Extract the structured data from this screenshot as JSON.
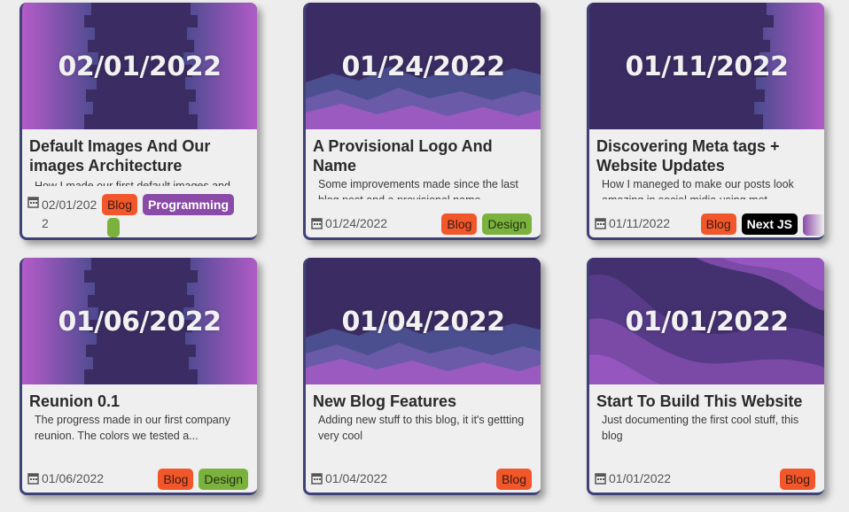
{
  "cards": [
    {
      "thumb_date": "02/01/2022",
      "title": "Default Images And Our images Architecture",
      "desc": "How I made our first default images and...",
      "date": "02/01/2022",
      "tags": [
        "Blog",
        "Programming"
      ]
    },
    {
      "thumb_date": "01/24/2022",
      "title": "A Provisional Logo And Name",
      "desc": "Some improvements made since the last blog post and a provisional name...",
      "date": "01/24/2022",
      "tags": [
        "Blog",
        "Design"
      ]
    },
    {
      "thumb_date": "01/11/2022",
      "title": "Discovering Meta tags + Website Updates",
      "desc": "How I maneged to make our posts look amazing in social midia using met...",
      "date": "01/11/2022",
      "tags": [
        "Blog",
        "Next JS"
      ]
    },
    {
      "thumb_date": "01/06/2022",
      "title": "Reunion 0.1",
      "desc": "The progress made in our first company reunion. The colors we tested a...",
      "date": "01/06/2022",
      "tags": [
        "Blog",
        "Design"
      ]
    },
    {
      "thumb_date": "01/04/2022",
      "title": "New Blog Features",
      "desc": "Adding new stuff to this blog, it it's gettting very cool",
      "date": "01/04/2022",
      "tags": [
        "Blog"
      ]
    },
    {
      "thumb_date": "01/01/2022",
      "title": "Start To Build This Website",
      "desc": "Just documenting the first cool stuff, this blog",
      "date": "01/01/2022",
      "tags": [
        "Blog"
      ]
    }
  ],
  "colors": {
    "blog": "#f2572b",
    "design": "#7bb23e",
    "programming": "#8a4aa7",
    "next_js": "#000000",
    "card_border": "#3f4277"
  }
}
